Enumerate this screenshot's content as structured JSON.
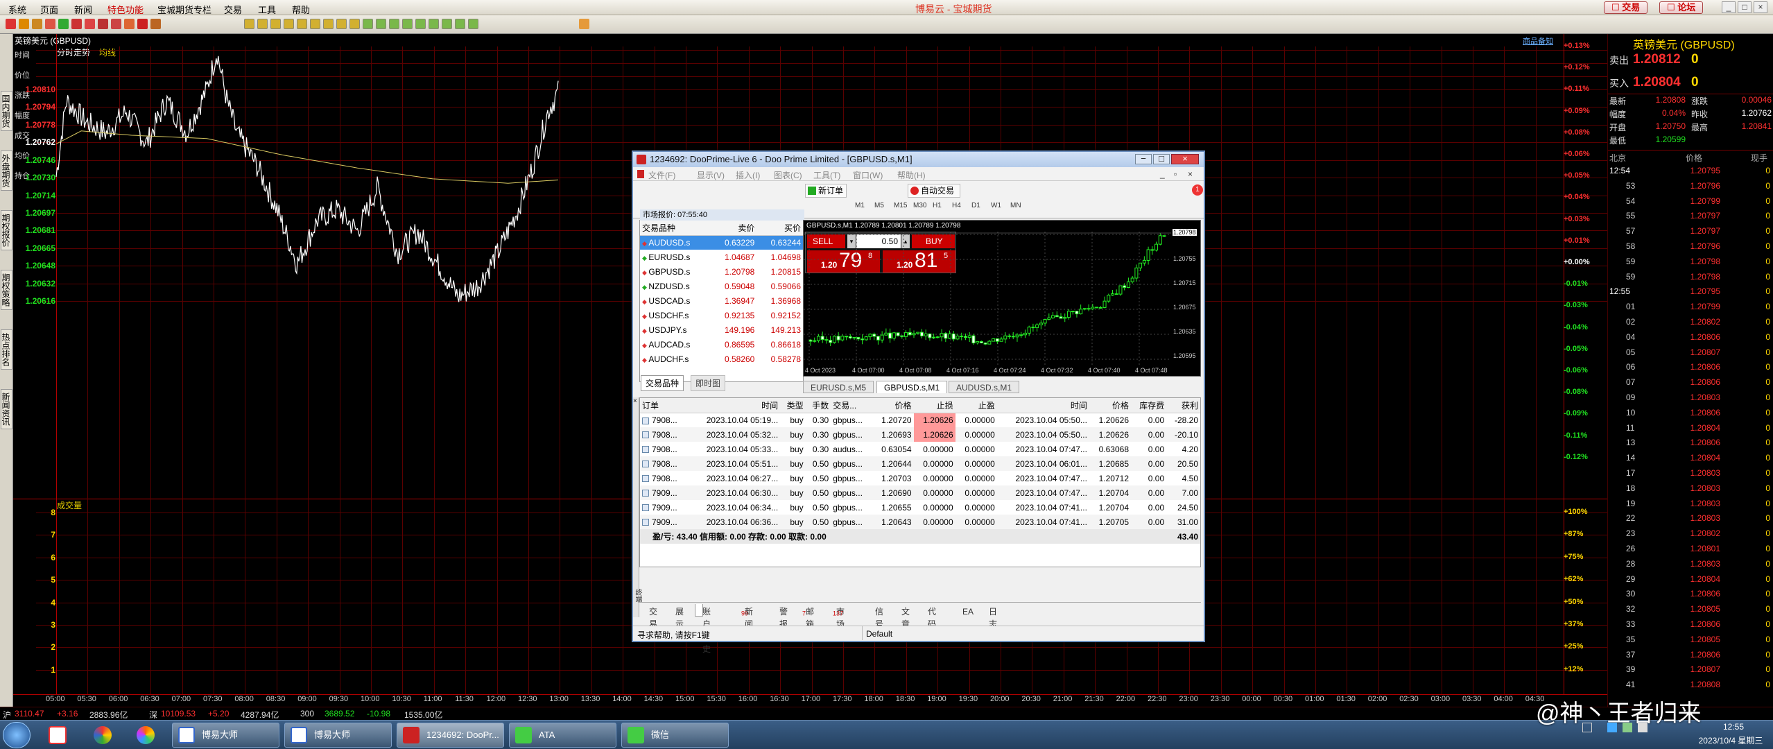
{
  "menubar": {
    "items": [
      "系统",
      "页面",
      "新闻",
      "特色功能",
      "宝城期货专栏",
      "交易",
      "工具",
      "帮助"
    ],
    "center_title": "博易云 - 宝城期货",
    "trade_btn": "交易",
    "forum_btn": "论坛"
  },
  "chart": {
    "title": "英镑美元 (GBPUSD)",
    "mode_tab": "分时走势",
    "avg_tab": "均线",
    "corner_link": "商品备知",
    "side_labels": [
      "时间",
      "价位",
      "涨跌",
      "幅度",
      "成交",
      "均价",
      "持仓"
    ],
    "y_prices": [
      "1.20810",
      "1.20794",
      "1.20778",
      "1.20762",
      "1.20746",
      "1.20730",
      "1.20714",
      "1.20697",
      "1.20681",
      "1.20665",
      "1.20648",
      "1.20632",
      "1.20616"
    ],
    "y_pct": [
      "+0.13%",
      "+0.12%",
      "+0.11%",
      "+0.09%",
      "+0.08%",
      "+0.06%",
      "+0.05%",
      "+0.04%",
      "+0.03%",
      "+0.01%",
      "+0.00%",
      "-0.01%",
      "-0.03%",
      "-0.04%",
      "-0.05%",
      "-0.06%",
      "-0.08%",
      "-0.09%",
      "-0.11%",
      "-0.12%"
    ],
    "volume_label": "成交量",
    "vol_ticks": [
      "8",
      "7",
      "6",
      "5",
      "4",
      "3",
      "2",
      "1"
    ],
    "vol_pct": [
      "+100%",
      "+87%",
      "+75%",
      "+62%",
      "+50%",
      "+37%",
      "+25%",
      "+12%"
    ],
    "x_ticks": [
      "05:00",
      "05:30",
      "06:00",
      "06:30",
      "07:00",
      "07:30",
      "08:00",
      "08:30",
      "09:00",
      "09:30",
      "10:00",
      "10:30",
      "11:00",
      "11:30",
      "12:00",
      "12:30",
      "13:00",
      "13:30",
      "14:00",
      "14:30",
      "15:00",
      "15:30",
      "16:00",
      "16:30",
      "17:00",
      "17:30",
      "18:00",
      "18:30",
      "19:00",
      "19:30",
      "20:00",
      "20:30",
      "21:00",
      "21:30",
      "22:00",
      "22:30",
      "23:00",
      "23:30",
      "00:00",
      "00:30",
      "01:00",
      "01:30",
      "02:00",
      "02:30",
      "03:00",
      "03:30",
      "04:00",
      "04:30"
    ],
    "price_line_color": "#ffffff",
    "avg_line_color": "#d8c860"
  },
  "right_panel": {
    "title": "英镑美元 (GBPUSD)",
    "sell_label": "卖出",
    "sell_price": "1.20812",
    "sell_vol": "0",
    "buy_label": "买入",
    "buy_price": "1.20804",
    "buy_vol": "0",
    "stats": [
      {
        "k": "最新",
        "v": "1.20808",
        "k2": "涨跌",
        "v2": "0.00046"
      },
      {
        "k": "幅度",
        "v": "0.04%",
        "k2": "昨收",
        "v2": "1.20762"
      },
      {
        "k": "开盘",
        "v": "1.20750",
        "k2": "最高",
        "v2": "1.20841"
      },
      {
        "k": "最低",
        "v": "1.20599",
        "k2": "",
        "v2": ""
      }
    ],
    "tick_headers": [
      "北京",
      "价格",
      "现手"
    ],
    "ticks": [
      {
        "t": "12:54",
        "p": "1.20795",
        "v": "0"
      },
      {
        "t": "53",
        "p": "1.20796",
        "v": "0"
      },
      {
        "t": "54",
        "p": "1.20799",
        "v": "0"
      },
      {
        "t": "55",
        "p": "1.20797",
        "v": "0"
      },
      {
        "t": "57",
        "p": "1.20797",
        "v": "0"
      },
      {
        "t": "58",
        "p": "1.20796",
        "v": "0"
      },
      {
        "t": "59",
        "p": "1.20798",
        "v": "0"
      },
      {
        "t": "59",
        "p": "1.20798",
        "v": "0"
      },
      {
        "t": "12:55",
        "p": "1.20795",
        "v": "0"
      },
      {
        "t": "01",
        "p": "1.20799",
        "v": "0"
      },
      {
        "t": "02",
        "p": "1.20802",
        "v": "0"
      },
      {
        "t": "04",
        "p": "1.20806",
        "v": "0"
      },
      {
        "t": "05",
        "p": "1.20807",
        "v": "0"
      },
      {
        "t": "06",
        "p": "1.20806",
        "v": "0"
      },
      {
        "t": "07",
        "p": "1.20806",
        "v": "0"
      },
      {
        "t": "09",
        "p": "1.20803",
        "v": "0"
      },
      {
        "t": "10",
        "p": "1.20806",
        "v": "0"
      },
      {
        "t": "11",
        "p": "1.20804",
        "v": "0"
      },
      {
        "t": "13",
        "p": "1.20806",
        "v": "0"
      },
      {
        "t": "14",
        "p": "1.20804",
        "v": "0"
      },
      {
        "t": "17",
        "p": "1.20803",
        "v": "0"
      },
      {
        "t": "18",
        "p": "1.20803",
        "v": "0"
      },
      {
        "t": "19",
        "p": "1.20803",
        "v": "0"
      },
      {
        "t": "22",
        "p": "1.20803",
        "v": "0"
      },
      {
        "t": "23",
        "p": "1.20802",
        "v": "0"
      },
      {
        "t": "26",
        "p": "1.20801",
        "v": "0"
      },
      {
        "t": "28",
        "p": "1.20803",
        "v": "0"
      },
      {
        "t": "29",
        "p": "1.20804",
        "v": "0"
      },
      {
        "t": "30",
        "p": "1.20806",
        "v": "0"
      },
      {
        "t": "32",
        "p": "1.20805",
        "v": "0"
      },
      {
        "t": "33",
        "p": "1.20806",
        "v": "0"
      },
      {
        "t": "35",
        "p": "1.20805",
        "v": "0"
      },
      {
        "t": "37",
        "p": "1.20806",
        "v": "0"
      },
      {
        "t": "39",
        "p": "1.20807",
        "v": "0"
      },
      {
        "t": "41",
        "p": "1.20808",
        "v": "0"
      }
    ]
  },
  "left_tabs": [
    "国内期货",
    "外盘期货",
    "期权报价",
    "期权策略",
    "热点排名",
    "新闻资讯"
  ],
  "index_bar": {
    "items": [
      {
        "n": "沪",
        "v": "3110.47",
        "c": "+3.16",
        "a": "2883.96亿"
      },
      {
        "n": "深",
        "v": "10109.53",
        "c": "+5.20",
        "a": "4287.94亿"
      },
      {
        "n": "300",
        "v": "3689.52",
        "c": "-10.98",
        "a": "1535.00亿"
      }
    ]
  },
  "taskbar": {
    "tasks": [
      "博易大师",
      "博易大师",
      "1234692: DooPr...",
      "ATA",
      "微信"
    ],
    "time": "12:55",
    "date": "2023/10/4 星期三",
    "watermark": "@神丶王者归来"
  },
  "mt4": {
    "title": "1234692: DooPrime-Live 6 - Doo Prime Limited - [GBPUSD.s,M1]",
    "menu": [
      "文件(F)",
      "显示(V)",
      "插入(I)",
      "图表(C)",
      "工具(T)",
      "窗口(W)",
      "帮助(H)"
    ],
    "new_order": "新订单",
    "auto_trade": "自动交易",
    "timeframes": [
      "M1",
      "M5",
      "M15",
      "M30",
      "H1",
      "H4",
      "D1",
      "W1",
      "MN"
    ],
    "mw_title": "市场报价: 07:55:40",
    "mw_headers": [
      "交易品种",
      "卖价",
      "买价"
    ],
    "mw_rows": [
      {
        "s": "AUDUSD.s",
        "b": "0.63229",
        "a": "0.63244"
      },
      {
        "s": "EURUSD.s",
        "b": "1.04687",
        "a": "1.04698"
      },
      {
        "s": "GBPUSD.s",
        "b": "1.20798",
        "a": "1.20815"
      },
      {
        "s": "NZDUSD.s",
        "b": "0.59048",
        "a": "0.59066"
      },
      {
        "s": "USDCAD.s",
        "b": "1.36947",
        "a": "1.36968"
      },
      {
        "s": "USDCHF.s",
        "b": "0.92135",
        "a": "0.92152"
      },
      {
        "s": "USDJPY.s",
        "b": "149.196",
        "a": "149.213"
      },
      {
        "s": "AUDCAD.s",
        "b": "0.86595",
        "a": "0.86618"
      },
      {
        "s": "AUDCHF.s",
        "b": "0.58260",
        "a": "0.58278"
      }
    ],
    "mw_tabs": [
      "交易品种",
      "即时图"
    ],
    "chart_info": "GBPUSD.s,M1  1.20789 1.20801 1.20789 1.20798",
    "sell": "SELL",
    "buy": "BUY",
    "lot": "0.50",
    "sell_big": "79",
    "sell_pre": "1.20",
    "sell_sup": "8",
    "buy_big": "81",
    "buy_pre": "1.20",
    "buy_sup": "5",
    "price_axis": [
      "1.20798",
      "1.20755",
      "1.20715",
      "1.20675",
      "1.20635",
      "1.20595"
    ],
    "time_axis": [
      "4 Oct 2023",
      "4 Oct 07:00",
      "4 Oct 07:08",
      "4 Oct 07:16",
      "4 Oct 07:24",
      "4 Oct 07:32",
      "4 Oct 07:40",
      "4 Oct 07:48"
    ],
    "chart_tabs": [
      "EURUSD.s,M5",
      "GBPUSD.s,M1",
      "AUDUSD.s,M1"
    ],
    "term_headers": [
      "订单",
      "时间",
      "类型",
      "手数",
      "交易...",
      "价格",
      "止损",
      "止盈",
      "时间",
      "价格",
      "库存费",
      "获利"
    ],
    "orders": [
      [
        "7908...",
        "2023.10.04 05:19...",
        "buy",
        "0.30",
        "gbpus...",
        "1.20720",
        "1.20626",
        "0.00000",
        "2023.10.04 05:50...",
        "1.20626",
        "0.00",
        "-28.20"
      ],
      [
        "7908...",
        "2023.10.04 05:32...",
        "buy",
        "0.30",
        "gbpus...",
        "1.20693",
        "1.20626",
        "0.00000",
        "2023.10.04 05:50...",
        "1.20626",
        "0.00",
        "-20.10"
      ],
      [
        "7908...",
        "2023.10.04 05:33...",
        "buy",
        "0.30",
        "audus...",
        "0.63054",
        "0.00000",
        "0.00000",
        "2023.10.04 07:47...",
        "0.63068",
        "0.00",
        "4.20"
      ],
      [
        "7908...",
        "2023.10.04 05:51...",
        "buy",
        "0.50",
        "gbpus...",
        "1.20644",
        "0.00000",
        "0.00000",
        "2023.10.04 06:01...",
        "1.20685",
        "0.00",
        "20.50"
      ],
      [
        "7908...",
        "2023.10.04 06:27...",
        "buy",
        "0.50",
        "gbpus...",
        "1.20703",
        "0.00000",
        "0.00000",
        "2023.10.04 07:47...",
        "1.20712",
        "0.00",
        "4.50"
      ],
      [
        "7909...",
        "2023.10.04 06:30...",
        "buy",
        "0.50",
        "gbpus...",
        "1.20690",
        "0.00000",
        "0.00000",
        "2023.10.04 07:47...",
        "1.20704",
        "0.00",
        "7.00"
      ],
      [
        "7909...",
        "2023.10.04 06:34...",
        "buy",
        "0.50",
        "gbpus...",
        "1.20655",
        "0.00000",
        "0.00000",
        "2023.10.04 07:41...",
        "1.20704",
        "0.00",
        "24.50"
      ],
      [
        "7909...",
        "2023.10.04 06:36...",
        "buy",
        "0.50",
        "gbpus...",
        "1.20643",
        "0.00000",
        "0.00000",
        "2023.10.04 07:41...",
        "1.20705",
        "0.00",
        "31.00"
      ]
    ],
    "summary": "盈/亏: 43.40  信用额: 0.00  存款: 0.00  取款: 0.00",
    "summary_total": "43.40",
    "term_side": "终端",
    "term_tabs": [
      {
        "l": "交易",
        "c": ""
      },
      {
        "l": "展示",
        "c": ""
      },
      {
        "l": "账户历史",
        "c": ""
      },
      {
        "l": "新闻",
        "c": "99"
      },
      {
        "l": "警报",
        "c": ""
      },
      {
        "l": "邮箱",
        "c": "7"
      },
      {
        "l": "市场",
        "c": "137"
      },
      {
        "l": "信号",
        "c": ""
      },
      {
        "l": "文章",
        "c": ""
      },
      {
        "l": "代码库",
        "c": ""
      },
      {
        "l": "EA",
        "c": ""
      },
      {
        "l": "日志",
        "c": ""
      }
    ],
    "status_help": "寻求帮助, 请按F1键",
    "status_profile": "Default"
  }
}
